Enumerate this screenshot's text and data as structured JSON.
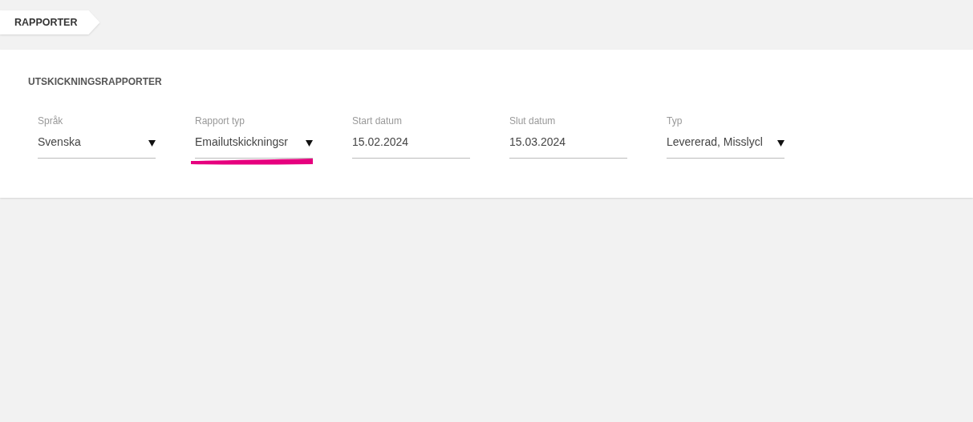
{
  "breadcrumb": "RAPPORTER",
  "section_title": "UTSKICKNINGSRAPPORTER",
  "fields": [
    {
      "kind": "select",
      "label": "Språk",
      "value": "Svenska"
    },
    {
      "kind": "select",
      "label": "Rapport typ",
      "value": "Emailutskickningsr",
      "highlighted": true
    },
    {
      "kind": "date",
      "label": "Start datum",
      "value": "15.02.2024"
    },
    {
      "kind": "date",
      "label": "Slut datum",
      "value": "15.03.2024"
    },
    {
      "kind": "select",
      "label": "Typ",
      "value": "Levererad, Misslycl"
    }
  ]
}
